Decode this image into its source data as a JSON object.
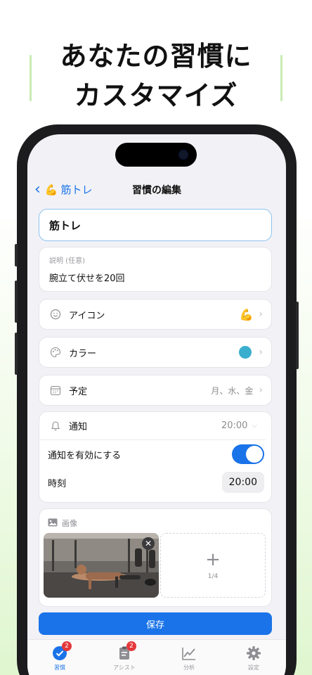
{
  "headline": {
    "line1": "あなたの習慣に",
    "line2": "カスタマイズ"
  },
  "nav": {
    "back_emoji": "💪",
    "back_label": "筋トレ",
    "title": "習慣の編集"
  },
  "form": {
    "name_value": "筋トレ",
    "description_label": "説明 (任意)",
    "description_value": "腕立て伏せを20回",
    "icon_row": {
      "label": "アイコン",
      "value": "💪"
    },
    "color_row": {
      "label": "カラー",
      "color": "#3aaecf"
    },
    "schedule_row": {
      "label": "予定",
      "value": "月、水、金"
    },
    "notification": {
      "label": "通知",
      "summary_time": "20:00",
      "enable_label": "通知を有効にする",
      "enabled": true,
      "time_label": "時刻",
      "time_value": "20:00"
    },
    "image": {
      "label": "画像",
      "slot_count": "1/4"
    },
    "save_label": "保存"
  },
  "tabbar": {
    "tabs": [
      {
        "label": "習慣",
        "badge": "2",
        "icon": "check-circle-icon",
        "active": true
      },
      {
        "label": "アシスト",
        "badge": "2",
        "icon": "clipboard-icon",
        "active": false
      },
      {
        "label": "分析",
        "badge": "",
        "icon": "chart-icon",
        "active": false
      },
      {
        "label": "設定",
        "badge": "",
        "icon": "gear-icon",
        "active": false
      }
    ]
  },
  "colors": {
    "accent": "#1a73e8",
    "badge": "#e5383b",
    "selected_color": "#3aaecf"
  }
}
